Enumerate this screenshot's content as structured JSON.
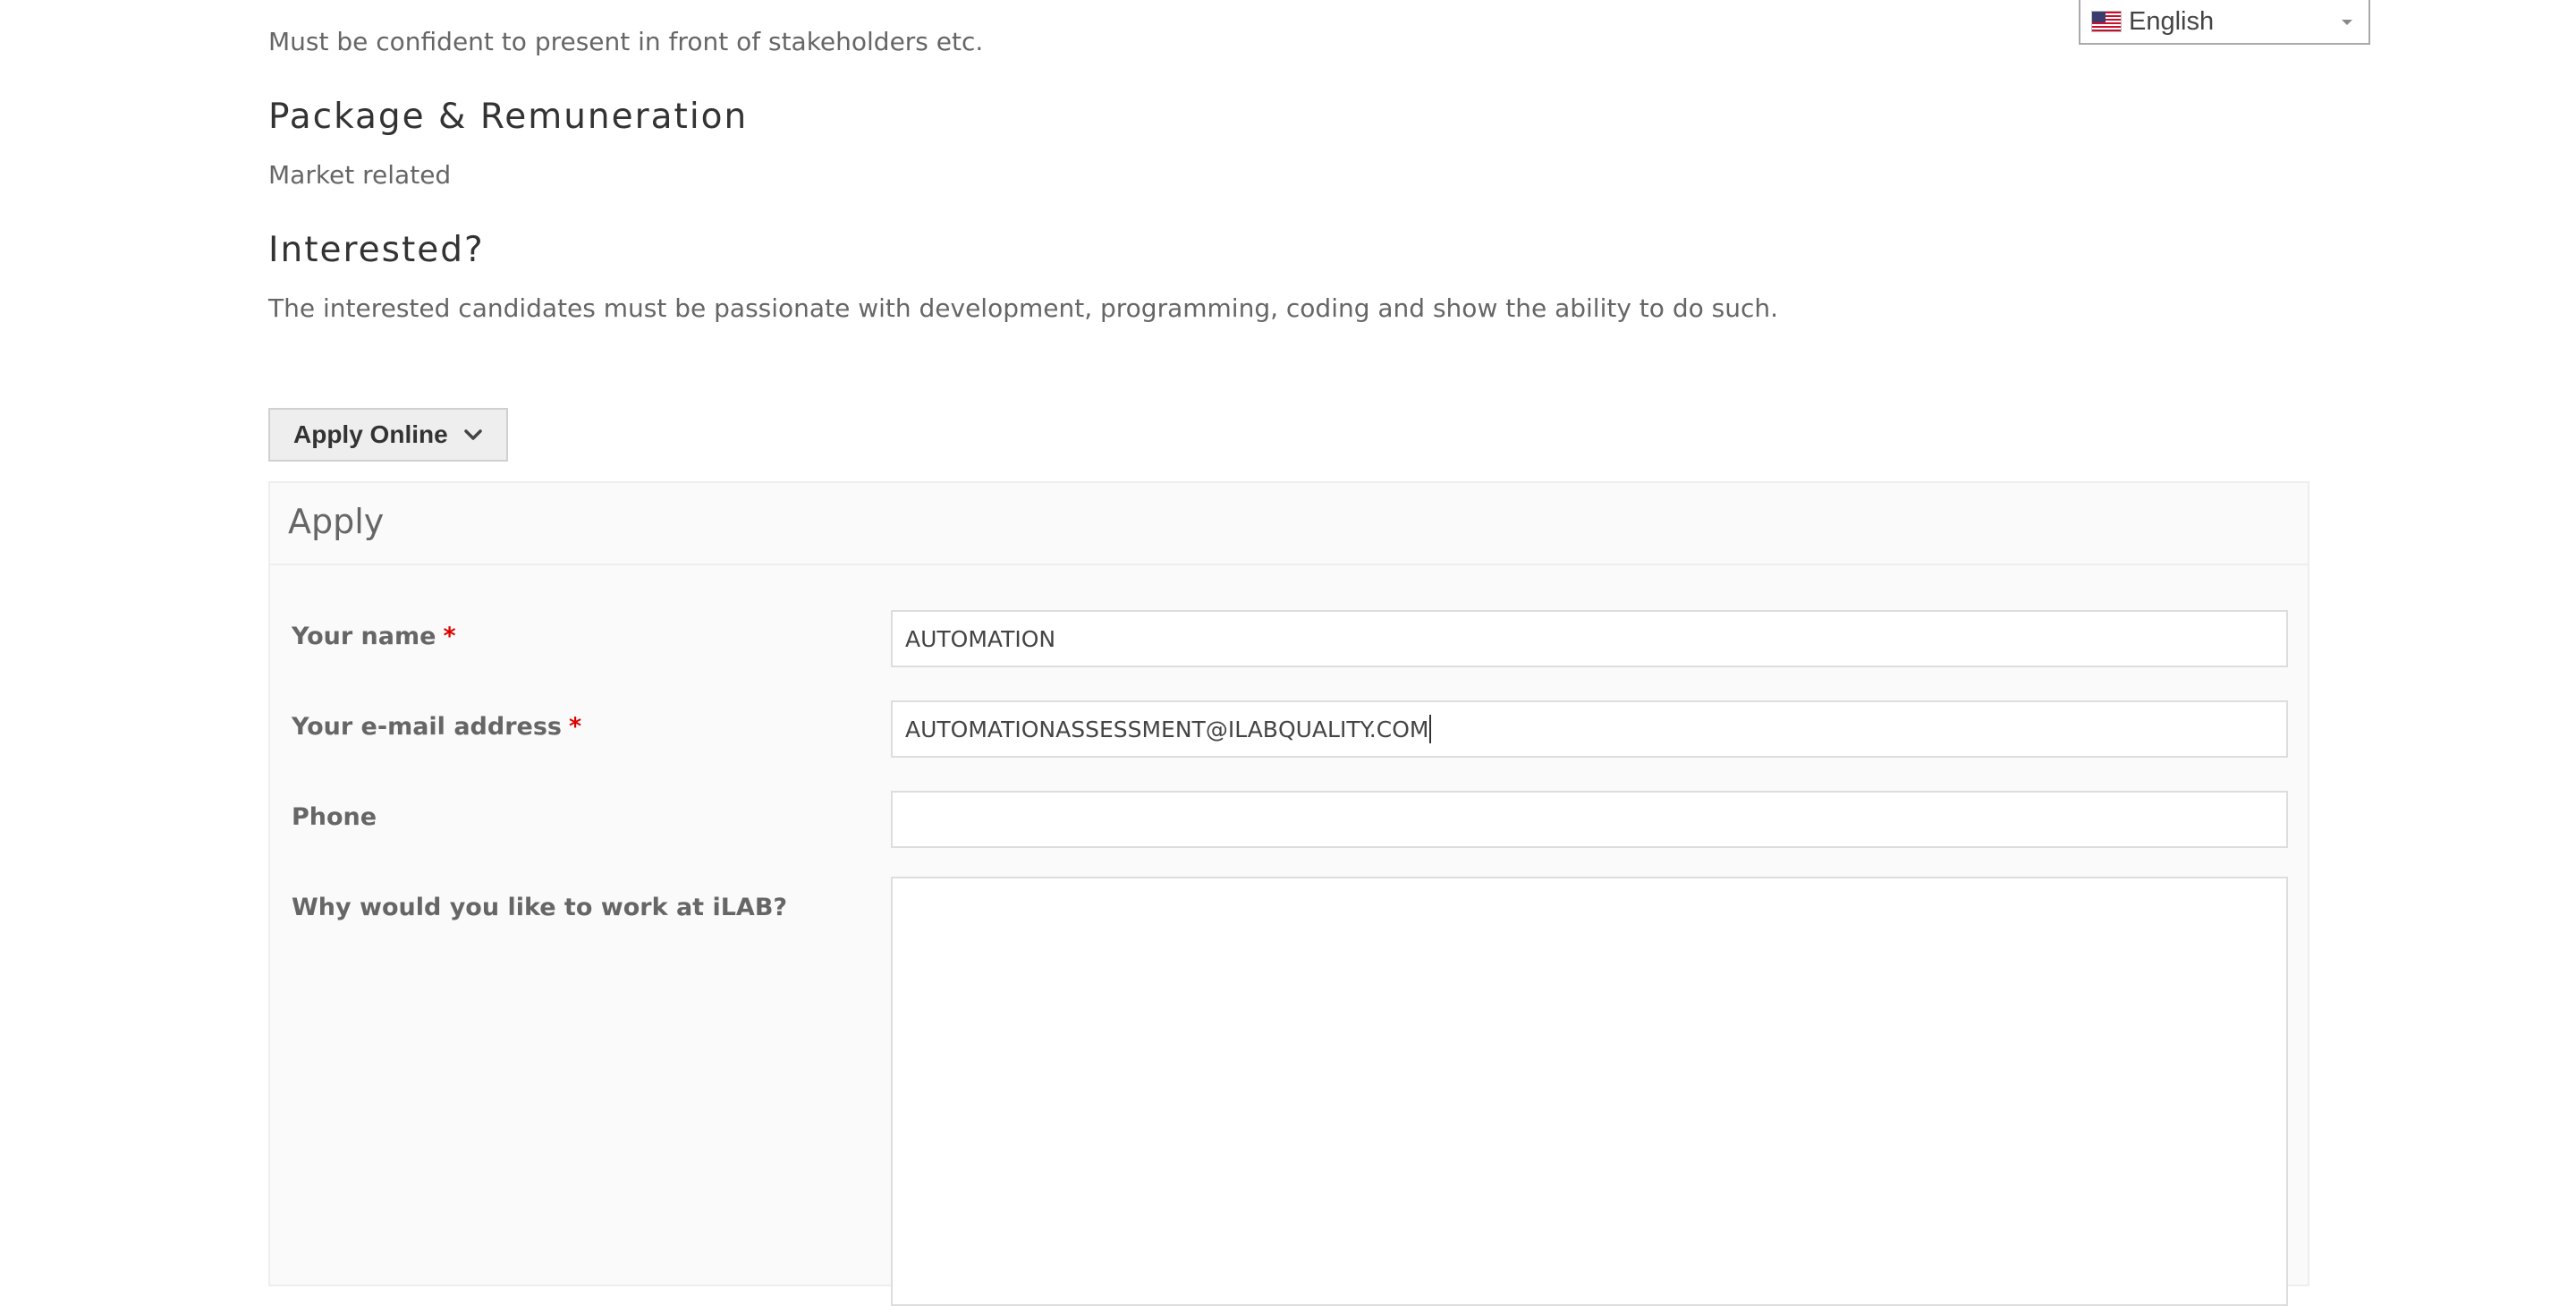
{
  "language_selector": {
    "selected": "English",
    "flag_icon": "us-flag-icon"
  },
  "job": {
    "presentation_text": "Must be confident to present in front of stakeholders etc.",
    "package_heading": "Package & Remuneration",
    "package_text": "Market related",
    "interested_heading": "Interested?",
    "interested_text": "The interested candidates must be passionate with development, programming, coding and show the ability to do such."
  },
  "apply_toggle": {
    "label": "Apply Online",
    "icon": "chevron-down-icon"
  },
  "apply_form": {
    "title": "Apply",
    "required_marker": "*",
    "fields": {
      "name": {
        "label": "Your name",
        "value": "AUTOMATION",
        "required": true
      },
      "email": {
        "label": "Your e-mail address",
        "value": "AUTOMATIONASSESSMENT@ILABQUALITY.COM",
        "required": true
      },
      "phone": {
        "label": "Phone",
        "value": "",
        "required": false
      },
      "why": {
        "label": "Why would you like to work at iLAB?",
        "value": "",
        "required": false
      }
    }
  },
  "colors": {
    "required_marker": "#dd0000",
    "text": "#666666",
    "heading": "#333333"
  }
}
